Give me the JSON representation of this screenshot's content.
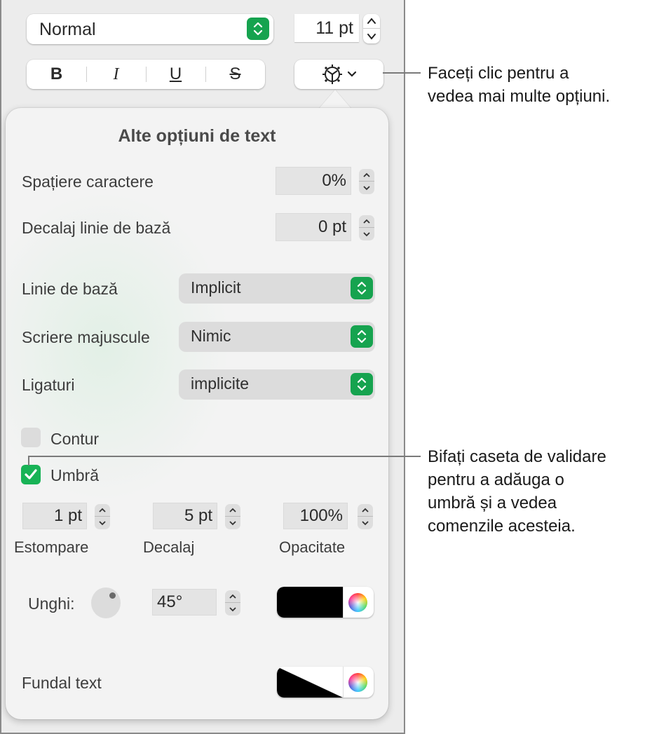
{
  "toolbar": {
    "paragraph_style": "Normal",
    "font_size": "11 pt",
    "format_buttons": {
      "bold": "B",
      "italic": "I",
      "underline": "U",
      "strikethrough": "S"
    },
    "more_options_icon": "gear-icon"
  },
  "panel": {
    "title": "Alte opțiuni de text",
    "character_spacing": {
      "label": "Spațiere caractere",
      "value": "0%"
    },
    "baseline_shift": {
      "label": "Decalaj linie de bază",
      "value": "0 pt"
    },
    "baseline": {
      "label": "Linie de bază",
      "value": "Implicit"
    },
    "capitalization": {
      "label": "Scriere majuscule",
      "value": "Nimic"
    },
    "ligatures": {
      "label": "Ligaturi",
      "value": "implicite"
    },
    "outline": {
      "label": "Contur",
      "checked": false
    },
    "shadow": {
      "label": "Umbră",
      "checked": true,
      "blur": {
        "label": "Estompare",
        "value": "1 pt"
      },
      "offset": {
        "label": "Decalaj",
        "value": "5 pt"
      },
      "opacity": {
        "label": "Opacitate",
        "value": "100%"
      },
      "angle": {
        "label": "Unghi:",
        "value": "45°"
      },
      "color": "#000000"
    },
    "text_background": {
      "label": "Fundal text",
      "color": "none"
    }
  },
  "callouts": [
    {
      "text_line1": "Faceți clic pentru a",
      "text_line2": "vedea mai multe opțiuni."
    },
    {
      "lines": [
        "Bifați caseta de validare",
        "pentru a adăuga o",
        "umbră și a vedea",
        "comenzile acesteia."
      ]
    }
  ],
  "colors": {
    "accent_green": "#16a34f",
    "checkbox_green": "#18b356"
  }
}
